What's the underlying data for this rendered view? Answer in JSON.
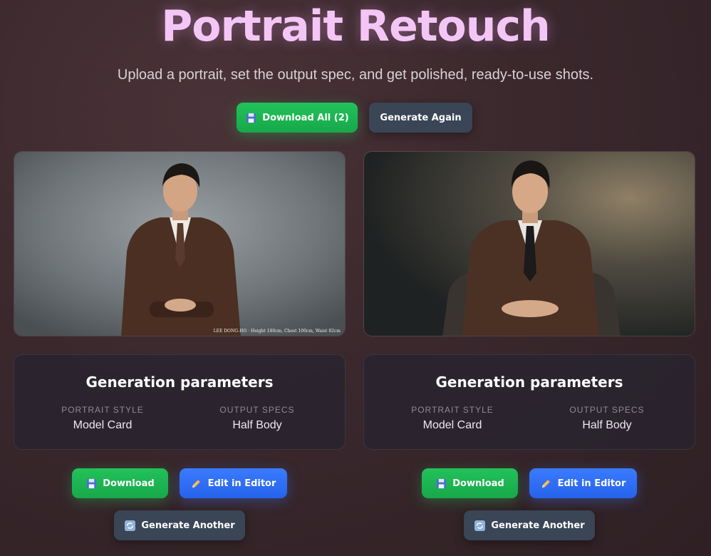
{
  "header": {
    "title": "Portrait Retouch",
    "subtitle": "Upload a portrait, set the output spec, and get polished, ready-to-use shots."
  },
  "toolbar": {
    "download_all_label": "Download All (2)",
    "download_all_icon": "floppy-disk-icon",
    "generate_again_label": "Generate Again"
  },
  "results": [
    {
      "caption": "LEE DONG-HO · Height 180cm, Chest 100cm, Waist 82cm",
      "params_title": "Generation parameters",
      "style_label": "PORTRAIT STYLE",
      "style_value": "Model Card",
      "specs_label": "OUTPUT SPECS",
      "specs_value": "Half Body",
      "download_label": "Download",
      "edit_label": "Edit in Editor",
      "another_label": "Generate Another"
    },
    {
      "caption": "",
      "params_title": "Generation parameters",
      "style_label": "PORTRAIT STYLE",
      "style_value": "Model Card",
      "specs_label": "OUTPUT SPECS",
      "specs_value": "Half Body",
      "download_label": "Download",
      "edit_label": "Edit in Editor",
      "another_label": "Generate Another"
    }
  ],
  "colors": {
    "title": "#f4c6f6",
    "green": "#22c25a",
    "blue": "#3b7bff",
    "slate": "#3a4556"
  }
}
